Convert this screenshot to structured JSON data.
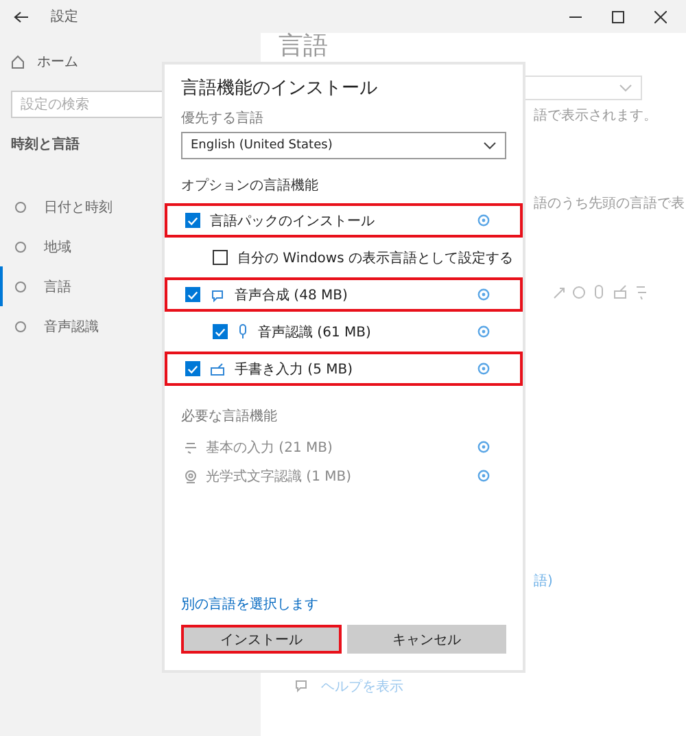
{
  "window": {
    "title": "設定"
  },
  "sidebar": {
    "home": "ホーム",
    "search": {
      "placeholder": "設定の検索"
    },
    "section": "時刻と言語",
    "items": [
      {
        "label": "日付と時刻",
        "selected": false
      },
      {
        "label": "地域",
        "selected": false
      },
      {
        "label": "言語",
        "selected": true
      },
      {
        "label": "音声認識",
        "selected": false
      }
    ]
  },
  "main": {
    "heading": "言語",
    "text_1": "語で表示されます。",
    "text_2": "語のうち先頭の言語で表",
    "link_fragment": "語)",
    "help_link": "ヘルプを表示"
  },
  "dialog": {
    "title": "言語機能のインストール",
    "preferred_label": "優先する言語",
    "preferred_value": "English (United States)",
    "optional_heading": "オプションの言語機能",
    "features": [
      {
        "label": "言語パックのインストール",
        "checked": true,
        "highlighted": true,
        "children": [
          {
            "label": "自分の Windows の表示言語として設定する",
            "checked": false,
            "highlighted": false
          }
        ]
      },
      {
        "label": "音声合成 (48 MB)",
        "checked": true,
        "highlighted": true,
        "children": [
          {
            "label": "音声認識 (61 MB)",
            "checked": true,
            "highlighted": false
          }
        ]
      },
      {
        "label": "手書き入力 (5 MB)",
        "checked": true,
        "highlighted": true
      }
    ],
    "required_heading": "必要な言語機能",
    "required": [
      {
        "label": "基本の入力 (21 MB)"
      },
      {
        "label": "光学式文字認識 (1 MB)"
      }
    ],
    "link": "別の言語を選択します",
    "buttons": [
      {
        "label": "インストール",
        "highlighted": true
      },
      {
        "label": "キャンセル",
        "highlighted": false
      }
    ]
  }
}
